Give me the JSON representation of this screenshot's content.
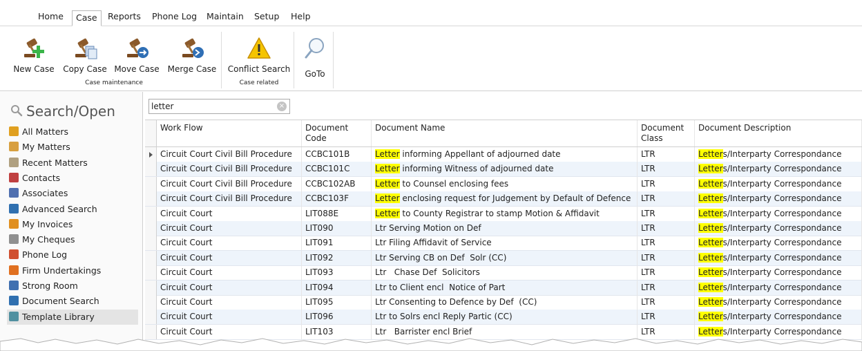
{
  "menu": {
    "tabs": [
      "Home",
      "Case",
      "Reports",
      "Phone Log",
      "Maintain",
      "Setup",
      "Help"
    ],
    "active": "Case"
  },
  "ribbon": {
    "buttons": {
      "new_case": "New Case",
      "copy_case": "Copy Case",
      "move_case": "Move Case",
      "merge_case": "Merge Case",
      "conflict_search": "Conflict Search",
      "goto": "GoTo"
    },
    "groups": {
      "case_maintenance": "Case maintenance",
      "case_related": "Case related"
    }
  },
  "sidebar": {
    "title": "Search/Open",
    "items": [
      {
        "label": "All Matters",
        "icon": "folder-icon",
        "color": "#e0a020"
      },
      {
        "label": "My Matters",
        "icon": "folder-person-icon",
        "color": "#d8a040"
      },
      {
        "label": "Recent Matters",
        "icon": "clock-folder-icon",
        "color": "#b0a080"
      },
      {
        "label": "Contacts",
        "icon": "address-book-icon",
        "color": "#c04040"
      },
      {
        "label": "Associates",
        "icon": "people-icon",
        "color": "#5070b0"
      },
      {
        "label": "Advanced Search",
        "icon": "magnify-icon",
        "color": "#3070b0"
      },
      {
        "label": "My Invoices",
        "icon": "coins-icon",
        "color": "#e09020"
      },
      {
        "label": "My Cheques",
        "icon": "pen-icon",
        "color": "#909090"
      },
      {
        "label": "Phone Log",
        "icon": "phone-icon",
        "color": "#d05030"
      },
      {
        "label": "Firm Undertakings",
        "icon": "badge-icon",
        "color": "#e07020"
      },
      {
        "label": "Strong Room",
        "icon": "safe-icon",
        "color": "#4070b0"
      },
      {
        "label": "Document Search",
        "icon": "doc-search-icon",
        "color": "#3070b0"
      },
      {
        "label": "Template Library",
        "icon": "template-icon",
        "color": "#5090a0"
      }
    ],
    "selected": "Template Library"
  },
  "search": {
    "value": "letter",
    "clear_glyph": "×"
  },
  "grid": {
    "columns": [
      "Work Flow",
      "Document Code",
      "Document Name",
      "Document Class",
      "Document Description"
    ],
    "rows": [
      {
        "workflow": "Circuit Court Civil Bill Procedure",
        "code": "CCBC101B",
        "name_hl": "Letter",
        "name_rest": " informing Appellant of adjourned date",
        "class": "LTR",
        "desc_hl": "Letter",
        "desc_rest": "s/Interparty Correspondance"
      },
      {
        "workflow": "Circuit Court Civil Bill Procedure",
        "code": "CCBC101C",
        "name_hl": "Letter",
        "name_rest": " informing Witness of adjourned date",
        "class": "LTR",
        "desc_hl": "Letter",
        "desc_rest": "s/Interparty Correspondance"
      },
      {
        "workflow": "Circuit Court Civil Bill Procedure",
        "code": "CCBC102AB",
        "name_hl": "Letter",
        "name_rest": " to Counsel enclosing fees",
        "class": "LTR",
        "desc_hl": "Letter",
        "desc_rest": "s/Interparty Correspondance"
      },
      {
        "workflow": "Circuit Court Civil Bill Procedure",
        "code": "CCBC103F",
        "name_hl": "Letter",
        "name_rest": " enclosing request for Judgement by Default of Defence",
        "class": "LTR",
        "desc_hl": "Letter",
        "desc_rest": "s/Interparty Correspondance"
      },
      {
        "workflow": "Circuit Court",
        "code": "LIT088E",
        "name_hl": "Letter",
        "name_rest": " to County Registrar to stamp Motion & Affidavit",
        "class": "LTR",
        "desc_hl": "Letter",
        "desc_rest": "s/Interparty Correspondance"
      },
      {
        "workflow": "Circuit Court",
        "code": "LIT090",
        "name_hl": "",
        "name_rest": "Ltr Serving Motion on Def",
        "class": "LTR",
        "desc_hl": "Letter",
        "desc_rest": "s/Interparty Correspondance"
      },
      {
        "workflow": "Circuit Court",
        "code": "LIT091",
        "name_hl": "",
        "name_rest": "Ltr Filing Affidavit of Service",
        "class": "LTR",
        "desc_hl": "Letter",
        "desc_rest": "s/Interparty Correspondance"
      },
      {
        "workflow": "Circuit Court",
        "code": "LIT092",
        "name_hl": "",
        "name_rest": "Ltr Serving CB on Def  Solr (CC)",
        "class": "LTR",
        "desc_hl": "Letter",
        "desc_rest": "s/Interparty Correspondance"
      },
      {
        "workflow": "Circuit Court",
        "code": "LIT093",
        "name_hl": "",
        "name_rest": "Ltr   Chase Def  Solicitors",
        "class": "LTR",
        "desc_hl": "Letter",
        "desc_rest": "s/Interparty Correspondance"
      },
      {
        "workflow": "Circuit Court",
        "code": "LIT094",
        "name_hl": "",
        "name_rest": "Ltr to Client encl  Notice of Part",
        "class": "LTR",
        "desc_hl": "Letter",
        "desc_rest": "s/Interparty Correspondance"
      },
      {
        "workflow": "Circuit Court",
        "code": "LIT095",
        "name_hl": "",
        "name_rest": "Ltr Consenting to Defence by Def  (CC)",
        "class": "LTR",
        "desc_hl": "Letter",
        "desc_rest": "s/Interparty Correspondance"
      },
      {
        "workflow": "Circuit Court",
        "code": "LIT096",
        "name_hl": "",
        "name_rest": "Ltr to Solrs encl Reply Partic (CC)",
        "class": "LTR",
        "desc_hl": "Letter",
        "desc_rest": "s/Interparty Correspondance"
      },
      {
        "workflow": "Circuit Court",
        "code": "LIT103",
        "name_hl": "",
        "name_rest": "Ltr   Barrister encl Brief",
        "class": "LTR",
        "desc_hl": "Letter",
        "desc_rest": "s/Interparty Correspondance"
      }
    ]
  },
  "colors": {
    "highlight": "#ffff00",
    "alt_row": "#eef4fb",
    "accent_green": "#3bb54a",
    "accent_blue": "#2f6fb5",
    "warning_yellow": "#f5c400"
  }
}
